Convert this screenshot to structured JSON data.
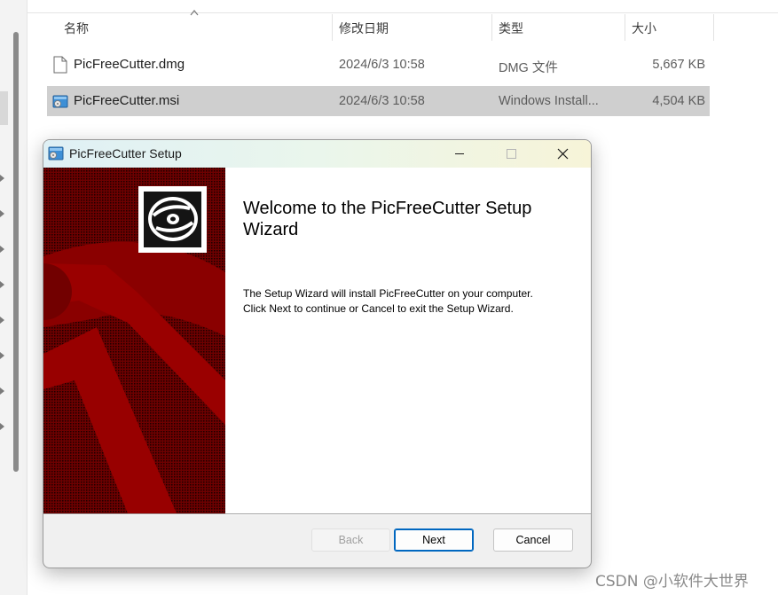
{
  "explorer": {
    "columns": {
      "name": "名称",
      "modified": "修改日期",
      "type": "类型",
      "size": "大小"
    },
    "files": [
      {
        "name": "PicFreeCutter.dmg",
        "modified": "2024/6/3 10:58",
        "type": "DMG 文件",
        "size": "5,667 KB",
        "icon": "blank-file-icon",
        "selected": false
      },
      {
        "name": "PicFreeCutter.msi",
        "modified": "2024/6/3 10:58",
        "type": "Windows Install...",
        "size": "4,504 KB",
        "icon": "installer-icon",
        "selected": true
      }
    ]
  },
  "dialog": {
    "title": "PicFreeCutter Setup",
    "heading": "Welcome to the PicFreeCutter Setup Wizard",
    "body_line1": "The Setup Wizard will install PicFreeCutter on your computer.",
    "body_line2": "Click Next to continue or Cancel to exit the Setup Wizard.",
    "buttons": {
      "back": "Back",
      "next": "Next",
      "cancel": "Cancel"
    },
    "back_enabled": false,
    "default_button": "next",
    "banner_color": "#7a0000",
    "accent_color": "#0067c0"
  },
  "watermark": "CSDN @小软件大世界"
}
